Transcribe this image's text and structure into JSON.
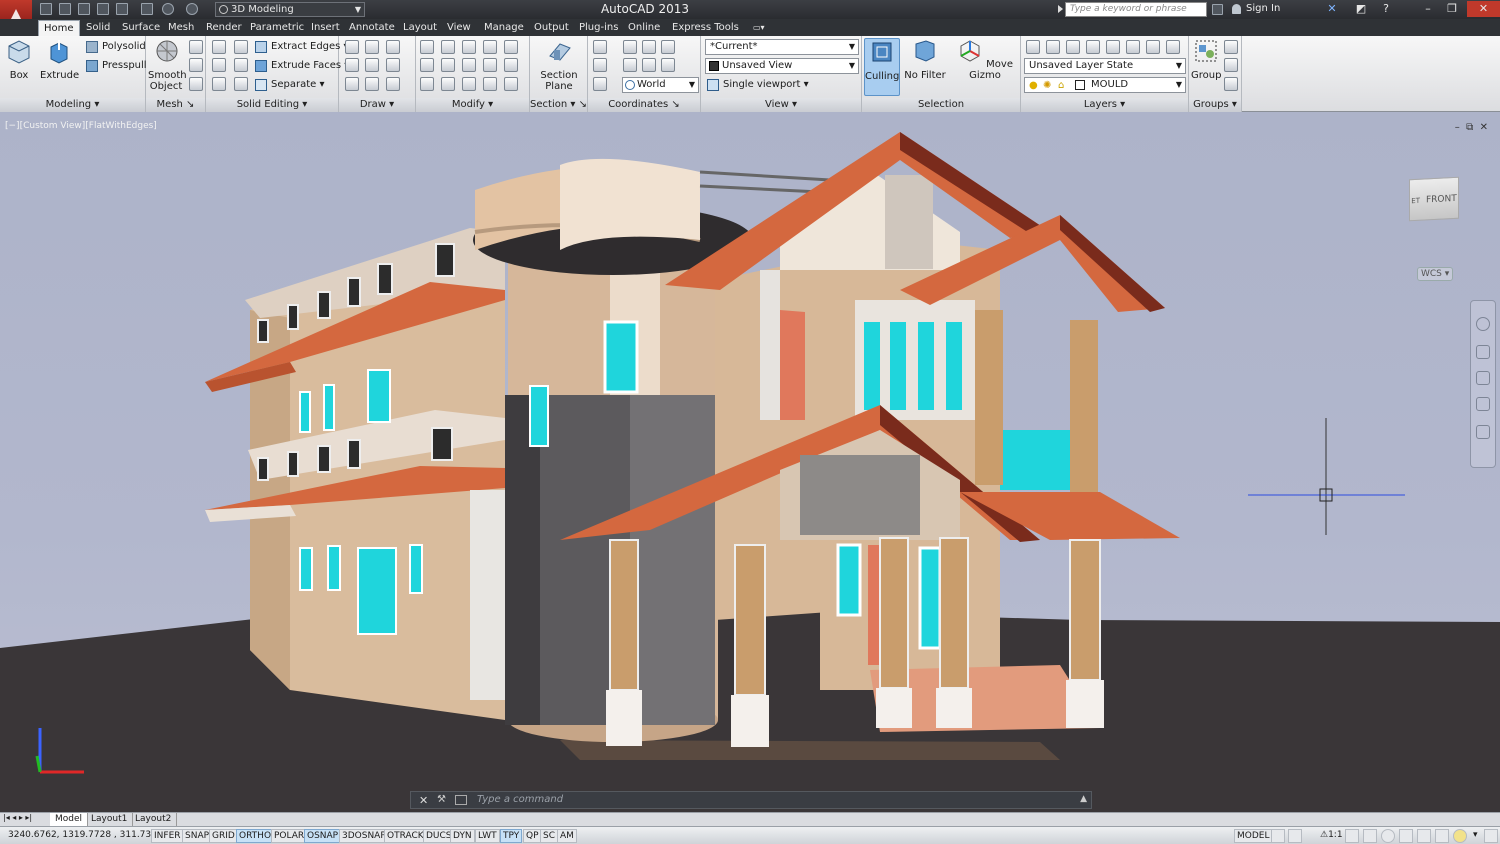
{
  "app": {
    "title": "AutoCAD 2013",
    "workspace": "3D Modeling"
  },
  "search": {
    "placeholder": "Type a keyword or phrase"
  },
  "account": {
    "signin": "Sign In"
  },
  "tabs": [
    "Home",
    "Solid",
    "Surface",
    "Mesh",
    "Render",
    "Parametric",
    "Insert",
    "Annotate",
    "Layout",
    "View",
    "Manage",
    "Output",
    "Plug-ins",
    "Online",
    "Express Tools"
  ],
  "active_tab": "Home",
  "ribbon": {
    "modeling": {
      "title": "Modeling",
      "box": "Box",
      "extrude": "Extrude",
      "polysolid": "Polysolid",
      "presspull": "Presspull"
    },
    "mesh": {
      "title": "Mesh",
      "smooth_object": "Smooth Object"
    },
    "solid_editing": {
      "title": "Solid Editing",
      "extract_edges": "Extract Edges",
      "extrude_faces": "Extrude Faces",
      "separate": "Separate"
    },
    "draw": {
      "title": "Draw"
    },
    "modify": {
      "title": "Modify"
    },
    "section": {
      "title": "Section",
      "section_plane": "Section Plane"
    },
    "coordinates": {
      "title": "Coordinates",
      "ucs": "World"
    },
    "view": {
      "title": "View",
      "visual_style": "*Current*",
      "named_view": "Unsaved View",
      "viewport": "Single viewport"
    },
    "selection": {
      "title": "Selection",
      "culling": "Culling",
      "no_filter": "No Filter",
      "move_gizmo": "Move Gizmo"
    },
    "layers": {
      "title": "Layers",
      "layer_state": "Unsaved Layer State",
      "current_layer": "MOULD"
    },
    "groups": {
      "title": "Groups",
      "group": "Group"
    }
  },
  "viewport": {
    "label": "[−][Custom View][FlatWithEdges]",
    "viewcube_face": "FRONT",
    "viewcube_side": "ET",
    "wcs": "WCS",
    "ctrl_min": "–",
    "ctrl_restore": "⧉",
    "ctrl_close": "✕"
  },
  "command": {
    "placeholder": "Type a command"
  },
  "layout_tabs": [
    "Model",
    "Layout1",
    "Layout2"
  ],
  "status": {
    "coords": "3240.6762, 1319.7728 , 311.7374",
    "toggles": [
      {
        "label": "INFER",
        "on": false
      },
      {
        "label": "SNAP",
        "on": false
      },
      {
        "label": "GRID",
        "on": false
      },
      {
        "label": "ORTHO",
        "on": true
      },
      {
        "label": "POLAR",
        "on": false
      },
      {
        "label": "OSNAP",
        "on": true
      },
      {
        "label": "3DOSNAP",
        "on": false
      },
      {
        "label": "OTRACK",
        "on": false
      },
      {
        "label": "DUCS",
        "on": false
      },
      {
        "label": "DYN",
        "on": false
      },
      {
        "label": "LWT",
        "on": false
      },
      {
        "label": "TPY",
        "on": true
      },
      {
        "label": "QP",
        "on": false
      },
      {
        "label": "SC",
        "on": false
      },
      {
        "label": "AM",
        "on": false
      }
    ],
    "space": "MODEL",
    "annotation_scale": "1:1"
  },
  "colors": {
    "roof": "#d4683f",
    "wall": "#d7b898",
    "glass": "#19d9df",
    "ground": "#3a3638",
    "sky": "#b0b5cb"
  }
}
